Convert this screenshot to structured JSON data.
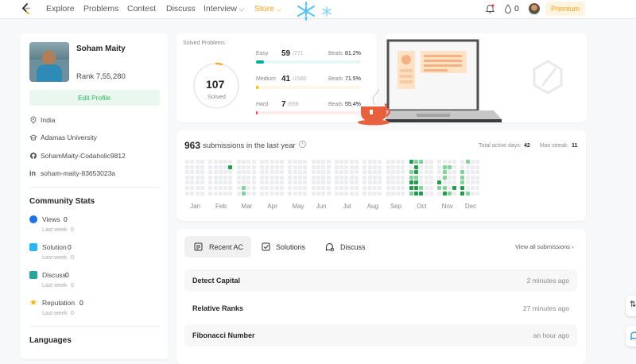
{
  "nav": {
    "items": [
      "Explore",
      "Problems",
      "Contest",
      "Discuss"
    ],
    "interview": "Interview",
    "store": "Store",
    "coins": "0",
    "premium": "Premium"
  },
  "profile": {
    "name": "Soham Maity",
    "username": "",
    "rank": "Rank 7,55,280",
    "edit": "Edit Profile",
    "country": "India",
    "school": "Adamas University",
    "github": "SohamMaity-Codaholic9812",
    "linkedin": "soham-maity-83653023a"
  },
  "community": {
    "title": "Community Stats",
    "stats": [
      {
        "label": "Views",
        "value": "0",
        "sub": "Last week",
        "subval": "0",
        "icon": "eye-icon",
        "color": "#1a73e8"
      },
      {
        "label": "Solution",
        "value": "0",
        "sub": "Last week",
        "subval": "0",
        "icon": "solution-icon",
        "color": "#29b6f6"
      },
      {
        "label": "Discuss",
        "value": "0",
        "sub": "Last week",
        "subval": "0",
        "icon": "chat-icon",
        "color": "#26a69a"
      },
      {
        "label": "Reputation",
        "value": "0",
        "sub": "Last week",
        "subval": "0",
        "icon": "star-icon",
        "color": "#ffb300"
      }
    ],
    "languages": "Languages"
  },
  "solved": {
    "title": "Solved Problems",
    "total": "107",
    "label": "Solved",
    "ring_fraction": 0.04,
    "rows": [
      {
        "name": "Easy",
        "count": "59",
        "total": "/771",
        "beats": "Beats",
        "pct": "81.2%",
        "fill": 0.076,
        "color": "#00af9b",
        "bg": "#e6f7f5"
      },
      {
        "name": "Medium",
        "count": "41",
        "total": "/1580",
        "beats": "Beats",
        "pct": "71.5%",
        "fill": 0.026,
        "color": "#ffb800",
        "bg": "#fff7e6"
      },
      {
        "name": "Hard",
        "count": "7",
        "total": "/658",
        "beats": "Beats",
        "pct": "55.4%",
        "fill": 0.011,
        "color": "#ef4743",
        "bg": "#fdecec"
      }
    ]
  },
  "submissions": {
    "count": "963",
    "label": "submissions in the last year",
    "active_label": "Total active days:",
    "active": "42",
    "streak_label": "Max streak:",
    "streak": "11",
    "months": [
      "Jan",
      "Feb",
      "Mar",
      "Apr",
      "May",
      "Jun",
      "Jul",
      "Aug",
      "Sep",
      "Oct",
      "Nov",
      "Dec"
    ]
  },
  "recent": {
    "tabs": [
      "Recent AC",
      "Solutions",
      "Discuss"
    ],
    "view_all": "View all submissions",
    "items": [
      {
        "title": "Detect Capital",
        "ago": "2 minutes ago"
      },
      {
        "title": "Relative Ranks",
        "ago": "27 minutes ago"
      },
      {
        "title": "Fibonacci Number",
        "ago": "an hour ago"
      }
    ]
  },
  "colors": {
    "green": "#2cbb5d",
    "dark_green": "#006d32",
    "light": "#ebedf0",
    "orange": "#ffa116"
  }
}
